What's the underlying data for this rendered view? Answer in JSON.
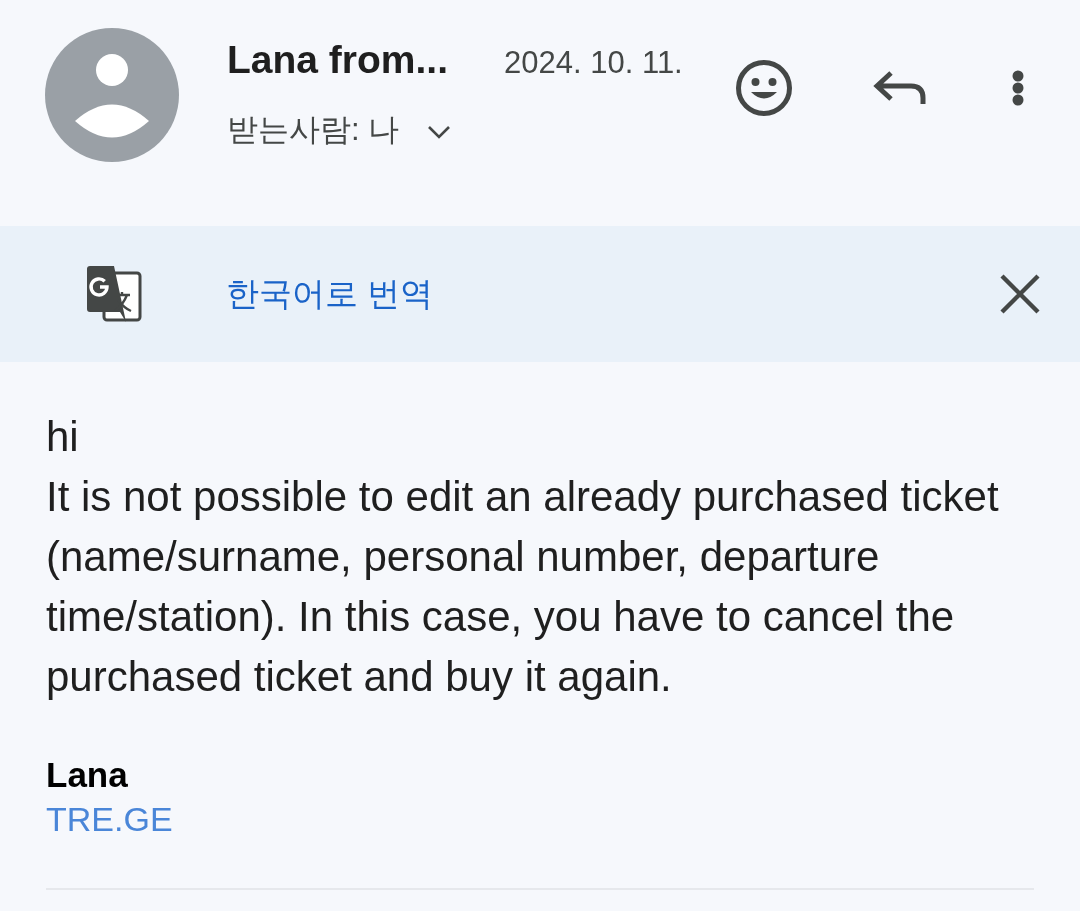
{
  "header": {
    "sender": "Lana from...",
    "date": "2024. 10. 11.",
    "recipient": "받는사람: 나",
    "recipient_expanded": false
  },
  "translate_bar": {
    "label": "한국어로 번역"
  },
  "body": {
    "lines": [
      "hi",
      "It is not possible to edit an already purchased ticket (name/surname, personal number, departure time/station). In this case, you have to cancel the purchased ticket and buy it again."
    ]
  },
  "signature": {
    "name": "Lana",
    "link": "TRE.GE"
  }
}
